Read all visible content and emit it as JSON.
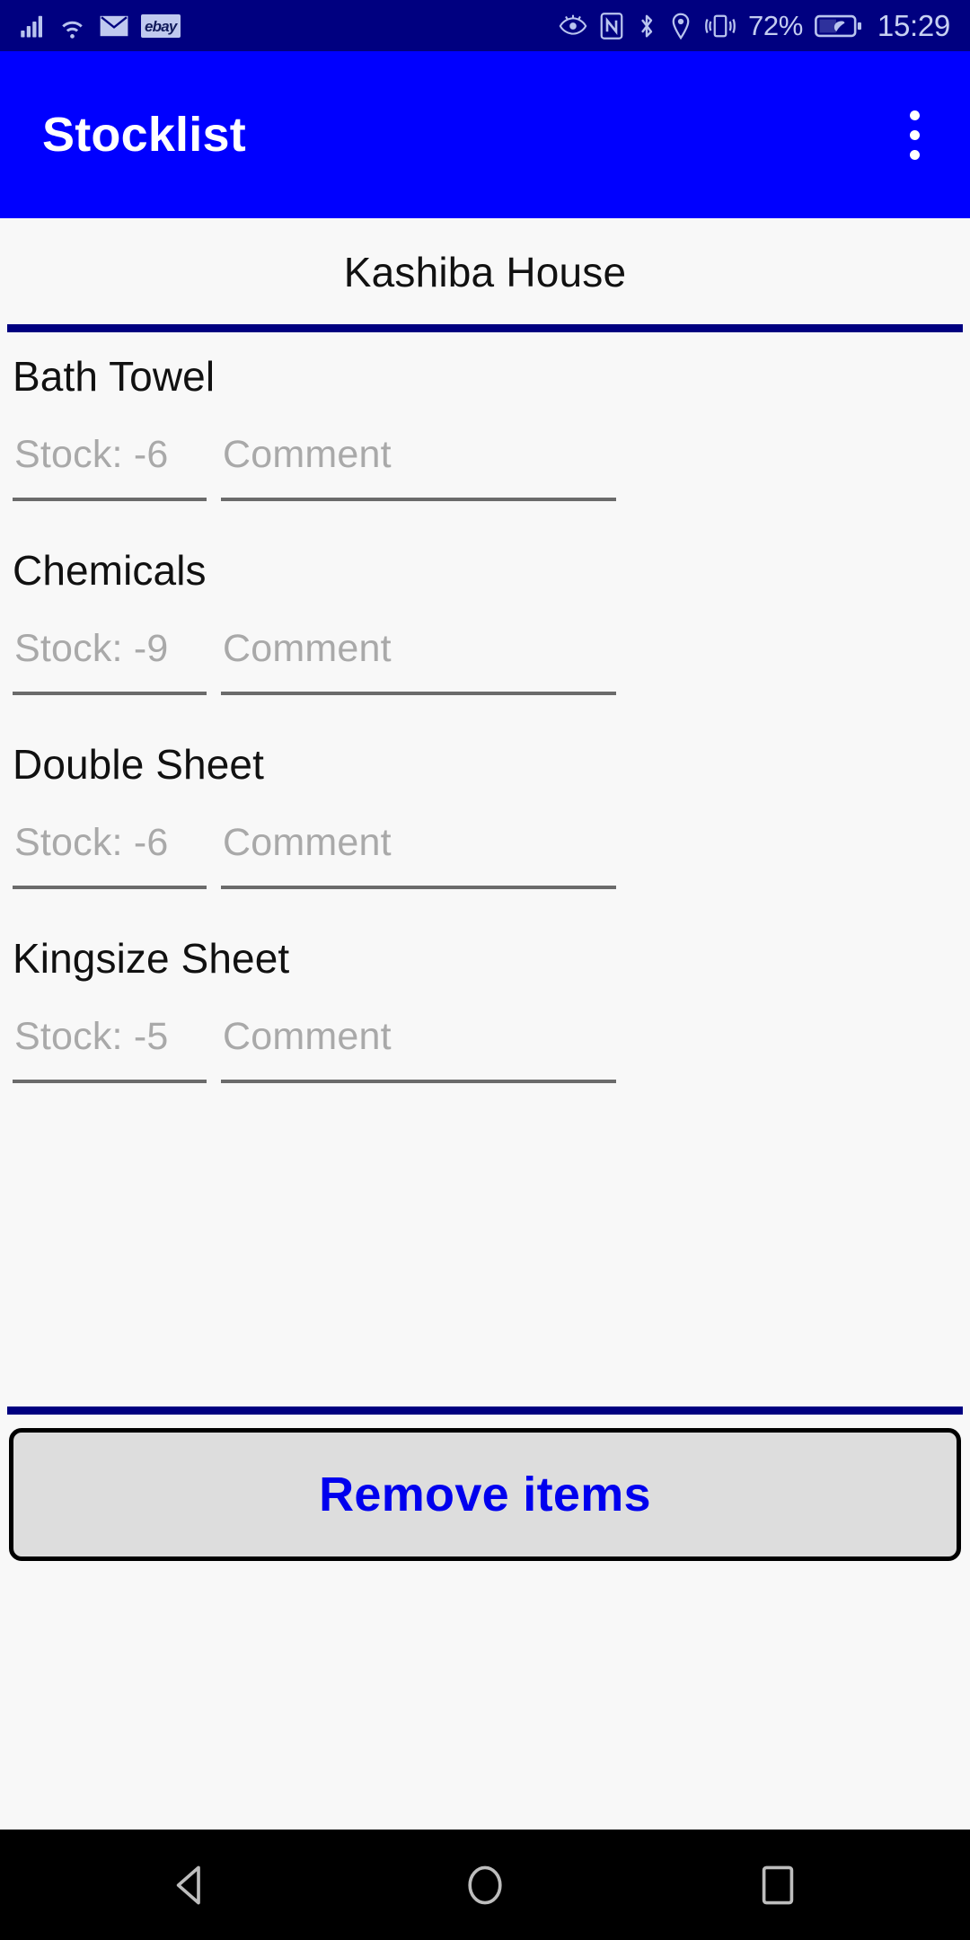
{
  "statusbar": {
    "left_icons": [
      {
        "name": "signal-bars-icon",
        "label": "signal"
      },
      {
        "name": "wifi-icon",
        "label": "wifi"
      },
      {
        "name": "email-icon",
        "label": "email"
      },
      {
        "name": "ebay-icon",
        "label": "ebay"
      }
    ],
    "ebay_label": "ebay",
    "right_icons": [
      {
        "name": "eye-comfort-icon",
        "label": "eye comfort"
      },
      {
        "name": "nfc-icon",
        "label": "nfc"
      },
      {
        "name": "bluetooth-icon",
        "label": "bluetooth"
      },
      {
        "name": "location-icon",
        "label": "location"
      },
      {
        "name": "vibrate-icon",
        "label": "vibrate"
      }
    ],
    "battery_percent": "72%",
    "battery_saver": "leaf",
    "time": "15:29",
    "background_color": "#000080",
    "icon_color": "#b9c4ee"
  },
  "appbar": {
    "title": "Stocklist",
    "overflow_menu": "more-options",
    "background_color": "#0000ff",
    "title_color": "#ffffff"
  },
  "tabs": [
    {
      "label": "Kashiba House",
      "selected": true
    }
  ],
  "tab_indicator_color": "#000080",
  "items": [
    {
      "name": "Bath Towel",
      "stock_value": "",
      "stock_placeholder": "Stock: -6",
      "comment_value": "",
      "comment_placeholder": "Comment"
    },
    {
      "name": "Chemicals",
      "stock_value": "",
      "stock_placeholder": "Stock: -9",
      "comment_value": "",
      "comment_placeholder": "Comment"
    },
    {
      "name": "Double Sheet",
      "stock_value": "",
      "stock_placeholder": "Stock: -6",
      "comment_value": "",
      "comment_placeholder": "Comment"
    },
    {
      "name": "Kingsize Sheet",
      "stock_value": "",
      "stock_placeholder": "Stock: -5",
      "comment_value": "",
      "comment_placeholder": "Comment"
    }
  ],
  "footer": {
    "remove_button_label": "Remove items",
    "remove_button_text_color": "#0000ee",
    "remove_button_background": "#dddddd",
    "divider_color": "#000080"
  },
  "navbar": {
    "back": "back",
    "home": "home",
    "recents": "recent-apps",
    "background_color": "#000000",
    "icon_color": "#bdbdbd"
  }
}
